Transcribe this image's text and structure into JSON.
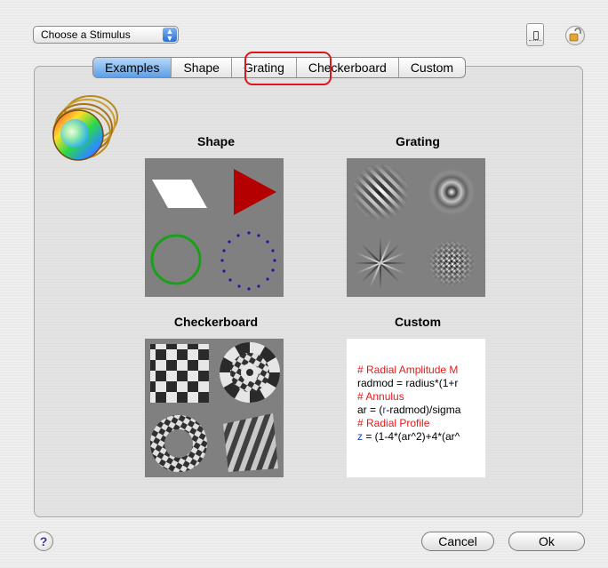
{
  "stimulus_popup": {
    "label": "Choose a Stimulus"
  },
  "tabs": [
    {
      "label": "Examples",
      "selected": true
    },
    {
      "label": "Shape",
      "selected": false
    },
    {
      "label": "Grating",
      "selected": false
    },
    {
      "label": "Checkerboard",
      "selected": false
    },
    {
      "label": "Custom",
      "selected": false
    }
  ],
  "examples": {
    "shape": {
      "title": "Shape"
    },
    "grating": {
      "title": "Grating"
    },
    "checkerboard": {
      "title": "Checkerboard"
    },
    "custom": {
      "title": "Custom",
      "code_lines": [
        {
          "text": "# Radial Amplitude M",
          "kind": "comment"
        },
        {
          "text": "radmod = radius*(1+r",
          "kind": "code"
        },
        {
          "text": "# Annulus",
          "kind": "comment"
        },
        {
          "text": "ar = (r-radmod)/sigma",
          "kind": "code"
        },
        {
          "text": "# Radial Profile",
          "kind": "comment"
        },
        {
          "text": "z = (1-4*(ar^2)+4*(ar^",
          "kind": "code"
        }
      ]
    }
  },
  "buttons": {
    "help": "?",
    "cancel": "Cancel",
    "ok": "Ok"
  },
  "colors": {
    "accent_tab": "#5d9ee6",
    "highlight": "#e0141e"
  }
}
